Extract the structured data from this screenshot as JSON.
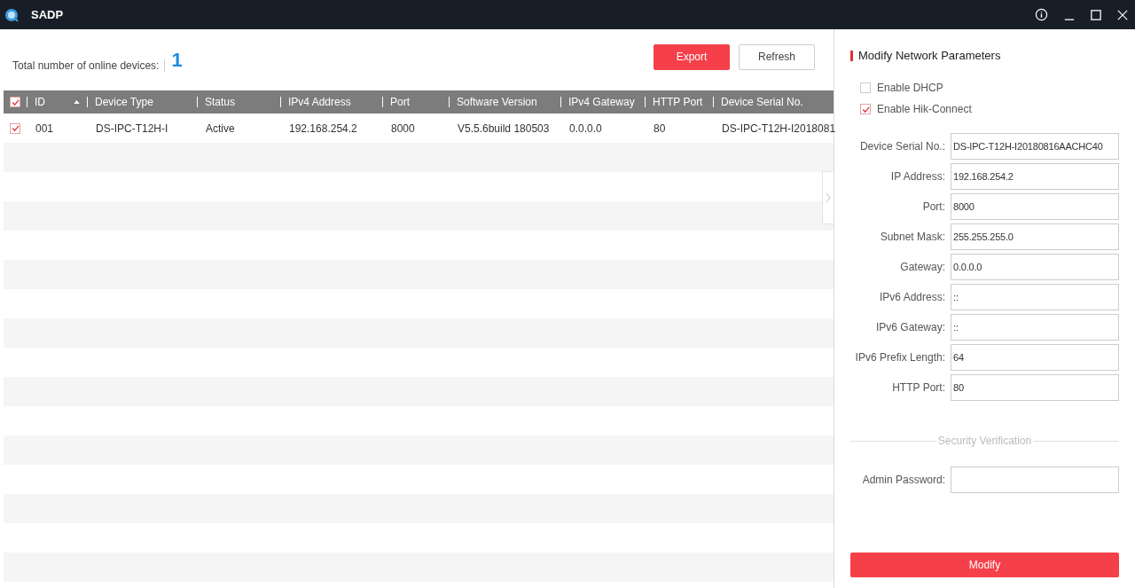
{
  "window": {
    "title": "SADP"
  },
  "summary": {
    "label": "Total number of online devices:",
    "count": "1"
  },
  "toolbar": {
    "buttons": [
      {
        "label": "Export",
        "kind": "primary"
      },
      {
        "label": "Refresh",
        "kind": "secondary"
      }
    ]
  },
  "table": {
    "all_checked": true,
    "columns": [
      {
        "label": "ID",
        "sorted": true
      },
      {
        "label": "Device Type",
        "sorted": false
      },
      {
        "label": "Status",
        "sorted": false
      },
      {
        "label": "IPv4 Address",
        "sorted": false
      },
      {
        "label": "Port",
        "sorted": false
      },
      {
        "label": "Software Version",
        "sorted": false
      },
      {
        "label": "IPv4 Gateway",
        "sorted": false
      },
      {
        "label": "HTTP Port",
        "sorted": false
      },
      {
        "label": "Device Serial No.",
        "sorted": false
      }
    ],
    "rows": [
      {
        "checked": true,
        "cells": [
          "001",
          "DS-IPC-T12H-I",
          "Active",
          "192.168.254.2",
          "8000",
          "V5.5.6build 180503",
          "0.0.0.0",
          "80",
          "DS-IPC-T12H-I2018081"
        ]
      }
    ]
  },
  "panel": {
    "title": "Modify Network Parameters",
    "options": [
      {
        "label": "Enable DHCP",
        "checked": false
      },
      {
        "label": "Enable Hik-Connect",
        "checked": true
      }
    ],
    "fields": [
      {
        "label": "Device Serial No.:",
        "value": "DS-IPC-T12H-I20180816AACHC40"
      },
      {
        "label": "IP Address:",
        "value": "192.168.254.2"
      },
      {
        "label": "Port:",
        "value": "8000"
      },
      {
        "label": "Subnet Mask:",
        "value": "255.255.255.0"
      },
      {
        "label": "Gateway:",
        "value": "0.0.0.0"
      },
      {
        "label": "IPv6 Address:",
        "value": "::"
      },
      {
        "label": "IPv6 Gateway:",
        "value": "::"
      },
      {
        "label": "IPv6 Prefix Length:",
        "value": "64"
      },
      {
        "label": "HTTP Port:",
        "value": "80"
      }
    ],
    "section_label": "Security Verification",
    "password": {
      "label": "Admin Password:"
    },
    "submit": "Modify"
  }
}
